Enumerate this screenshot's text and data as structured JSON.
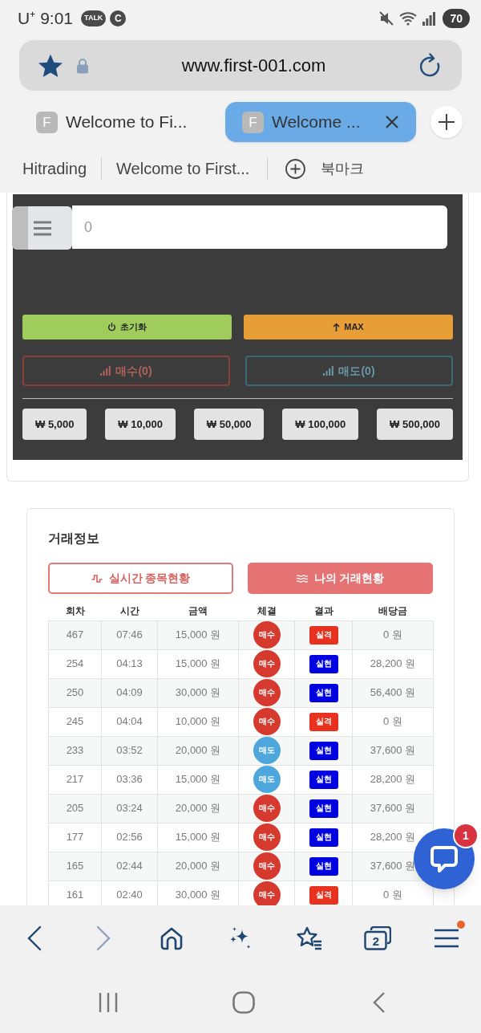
{
  "status_bar": {
    "carrier": "U⁺",
    "time": "9:01",
    "notifications": [
      {
        "kind": "talk",
        "label": "TALK"
      },
      {
        "kind": "letter",
        "label": "C"
      }
    ],
    "battery": "70"
  },
  "address_bar": {
    "url": "www.first-001.com",
    "bookmarked": true
  },
  "browser_tabs": [
    {
      "favicon": "F",
      "title": "Welcome to Fi...",
      "selected": false
    },
    {
      "favicon": "F",
      "title": "Welcome ...",
      "selected": true
    }
  ],
  "bookmarks_bar": {
    "links": [
      "Hitrading",
      "Welcome to First..."
    ],
    "add_label": "북마크"
  },
  "order_panel": {
    "amount": "0",
    "actions": [
      {
        "kind": "reset",
        "label": "초기화"
      },
      {
        "kind": "max",
        "label": "MAX"
      }
    ],
    "orders": [
      {
        "kind": "buy",
        "label": "매수(0)",
        "disabled": true
      },
      {
        "kind": "sell",
        "label": "매도(0)",
        "disabled": true
      }
    ],
    "quick_amounts": [
      "₩ 5,000",
      "₩ 10,000",
      "₩ 50,000",
      "₩ 100,000",
      "₩ 500,000"
    ]
  },
  "trade_info": {
    "title": "거래정보",
    "tabs": [
      {
        "kind": "live",
        "label": "실시간 종목현황",
        "selected": false
      },
      {
        "kind": "mine",
        "label": "나의 거래현황",
        "selected": true
      }
    ],
    "table": {
      "columns": [
        "회차",
        "시간",
        "금액",
        "체결",
        "결과",
        "배당금"
      ],
      "rows": [
        {
          "round": "467",
          "time": "07:46",
          "amount": "15,000 원",
          "fill": {
            "label": "매수",
            "color": "#d63a2f"
          },
          "result": {
            "label": "실격",
            "color": "#e8321f"
          },
          "payout": "0 원"
        },
        {
          "round": "254",
          "time": "04:13",
          "amount": "15,000 원",
          "fill": {
            "label": "매수",
            "color": "#d63a2f"
          },
          "result": {
            "label": "실현",
            "color": "#0000e0"
          },
          "payout": "28,200 원"
        },
        {
          "round": "250",
          "time": "04:09",
          "amount": "30,000 원",
          "fill": {
            "label": "매수",
            "color": "#d63a2f"
          },
          "result": {
            "label": "실현",
            "color": "#0000e0"
          },
          "payout": "56,400 원"
        },
        {
          "round": "245",
          "time": "04:04",
          "amount": "10,000 원",
          "fill": {
            "label": "매수",
            "color": "#d63a2f"
          },
          "result": {
            "label": "실격",
            "color": "#e8321f"
          },
          "payout": "0 원"
        },
        {
          "round": "233",
          "time": "03:52",
          "amount": "20,000 원",
          "fill": {
            "label": "매도",
            "color": "#4da6dc"
          },
          "result": {
            "label": "실현",
            "color": "#0000e0"
          },
          "payout": "37,600 원"
        },
        {
          "round": "217",
          "time": "03:36",
          "amount": "15,000 원",
          "fill": {
            "label": "매도",
            "color": "#4da6dc"
          },
          "result": {
            "label": "실현",
            "color": "#0000e0"
          },
          "payout": "28,200 원"
        },
        {
          "round": "205",
          "time": "03:24",
          "amount": "20,000 원",
          "fill": {
            "label": "매수",
            "color": "#d63a2f"
          },
          "result": {
            "label": "실현",
            "color": "#0000e0"
          },
          "payout": "37,600 원"
        },
        {
          "round": "177",
          "time": "02:56",
          "amount": "15,000 원",
          "fill": {
            "label": "매수",
            "color": "#d63a2f"
          },
          "result": {
            "label": "실현",
            "color": "#0000e0"
          },
          "payout": "28,200 원"
        },
        {
          "round": "165",
          "time": "02:44",
          "amount": "20,000 원",
          "fill": {
            "label": "매수",
            "color": "#d63a2f"
          },
          "result": {
            "label": "실현",
            "color": "#0000e0"
          },
          "payout": "37,600 원"
        },
        {
          "round": "161",
          "time": "02:40",
          "amount": "30,000 원",
          "fill": {
            "label": "매수",
            "color": "#d63a2f"
          },
          "result": {
            "label": "실격",
            "color": "#e8321f"
          },
          "payout": "0 원"
        }
      ]
    }
  },
  "chat_button": {
    "unread": "1"
  },
  "bottom_toolbar": {
    "forward_disabled": true,
    "tab_count": "2",
    "menu_badge": true
  }
}
